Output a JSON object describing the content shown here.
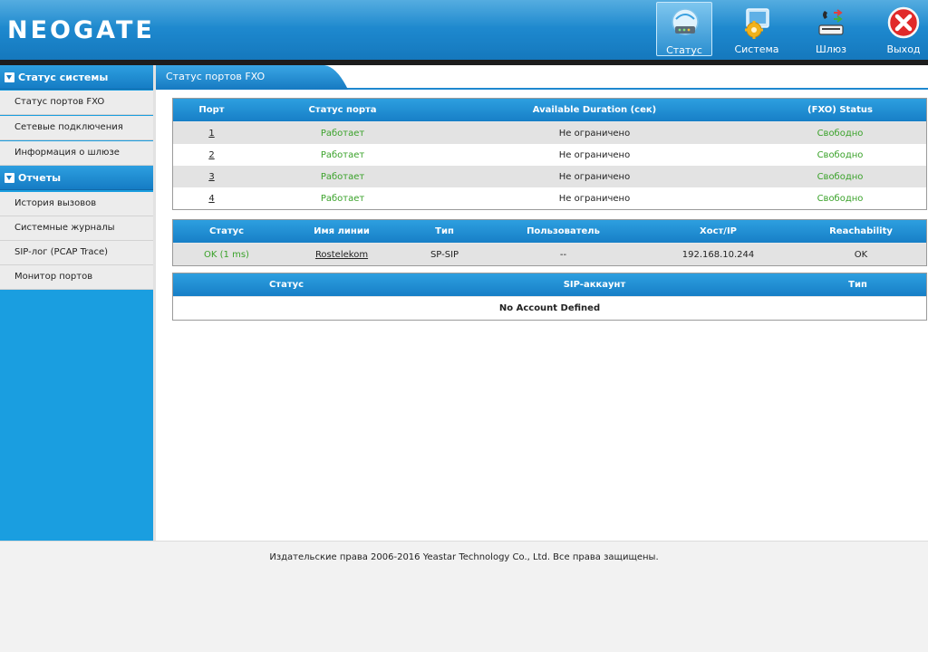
{
  "header": {
    "logo": "NEOGATE",
    "nav": [
      {
        "label": "Статус",
        "icon": "status-router-icon",
        "active": true
      },
      {
        "label": "Система",
        "icon": "system-gear-icon",
        "active": false
      },
      {
        "label": "Шлюз",
        "icon": "gateway-phone-icon",
        "active": false
      },
      {
        "label": "Выход",
        "icon": "exit-close-icon",
        "active": false
      }
    ]
  },
  "sidebar": {
    "sections": [
      {
        "title": "Статус системы",
        "items": [
          "Статус портов FXO",
          "Сетевые подключения",
          "Информация о шлюзе"
        ]
      },
      {
        "title": "Отчеты",
        "items": [
          "История вызовов",
          "Системные журналы",
          "SIP-лог (PCAP Trace)",
          "Монитор портов"
        ]
      }
    ]
  },
  "content": {
    "tab_title": "Статус портов FXO",
    "fxo_table": {
      "headers": [
        "Порт",
        "Статус порта",
        "Available Duration (сек)",
        "(FXO) Status"
      ],
      "rows": [
        [
          "1",
          "Работает",
          "Не ограничено",
          "Свободно"
        ],
        [
          "2",
          "Работает",
          "Не ограничено",
          "Свободно"
        ],
        [
          "3",
          "Работает",
          "Не ограничено",
          "Свободно"
        ],
        [
          "4",
          "Работает",
          "Не ограничено",
          "Свободно"
        ]
      ]
    },
    "trunk_table": {
      "headers": [
        "Статус",
        "Имя линии",
        "Тип",
        "Пользователь",
        "Хост/IP",
        "Reachability"
      ],
      "rows": [
        [
          "OK (1 ms)",
          "Rostelekom",
          "SP-SIP",
          "--",
          "192.168.10.244",
          "OK"
        ]
      ]
    },
    "sip_table": {
      "headers": [
        "Статус",
        "SIP-аккаунт",
        "Тип"
      ],
      "empty_text": "No Account Defined"
    }
  },
  "footer": {
    "copyright": "Издательские права 2006-2016 Yeastar Technology Co., Ltd. Все права защищены."
  },
  "colors": {
    "header_blue": "#1c86cc",
    "sidebar_blue": "#1a9ee0",
    "status_green": "#3aa22a"
  }
}
